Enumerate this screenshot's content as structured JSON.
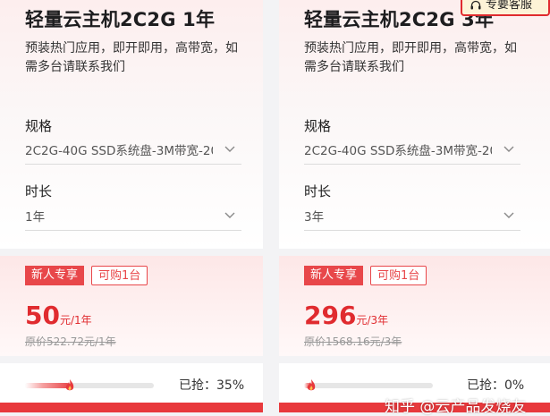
{
  "cards": [
    {
      "title": "轻量云主机2C2G 1年",
      "description": "预装热门应用，即开即用，高带宽，如需多台请联系我们",
      "spec_label": "规格",
      "spec_value": "2C2G-40G SSD系统盘-3M带宽-20",
      "duration_label": "时长",
      "duration_value": "1年",
      "tag_new": "新人专享",
      "tag_limit": "可购1台",
      "price": "50",
      "price_unit": "元/1年",
      "original_price": "原价522.72元/1年",
      "sold_label": "已抢：35%",
      "progress": 0.35
    },
    {
      "title": "轻量云主机2C2G 3年",
      "description": "预装热门应用，即开即用，高带宽，如需多台请联系我们",
      "spec_label": "规格",
      "spec_value": "2C2G-40G SSD系统盘-3M带宽-20",
      "duration_label": "时长",
      "duration_value": "3年",
      "tag_new": "新人专享",
      "tag_limit": "可购1台",
      "price": "296",
      "price_unit": "元/3年",
      "original_price": "原价1568.16元/3年",
      "sold_label": "已抢：0%",
      "progress": 0.0
    }
  ],
  "service_button": {
    "label": "专要客服",
    "icon": "headset-icon"
  },
  "watermark": "知乎 @云产品发烧友",
  "colors": {
    "accent": "#e8474a",
    "price": "#e02b2f",
    "service_bg": "#fdf3d7"
  }
}
